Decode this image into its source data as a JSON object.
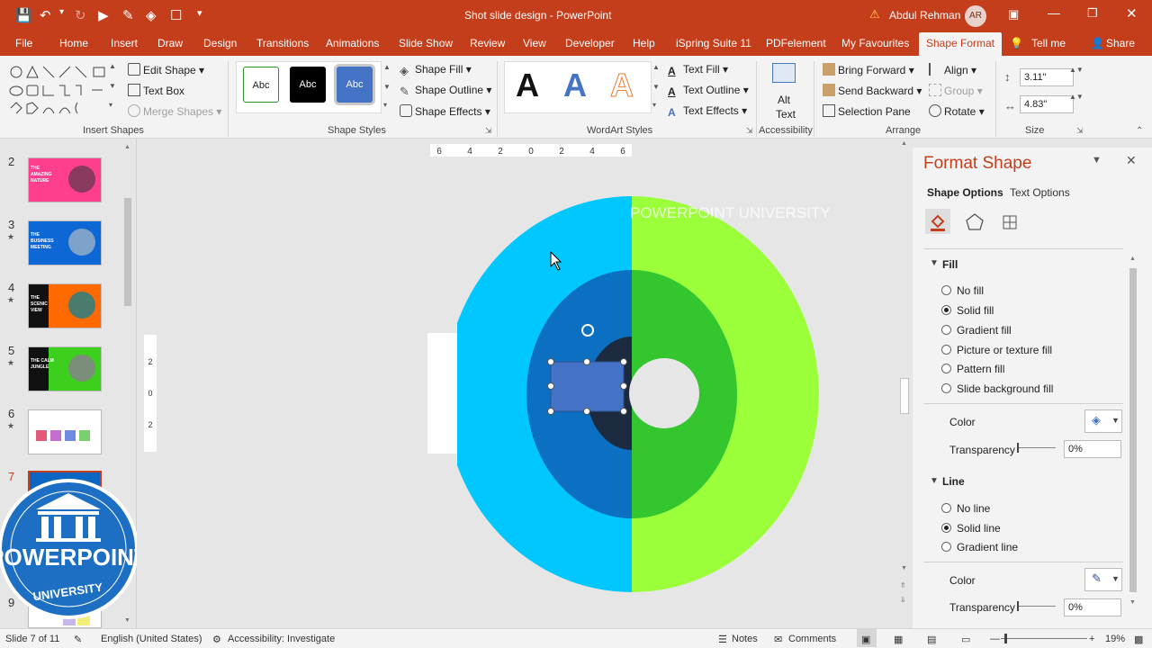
{
  "window": {
    "title": "Shot slide design - PowerPoint",
    "user_name": "Abdul Rehman",
    "user_initials": "AR"
  },
  "tabs": [
    "File",
    "Home",
    "Insert",
    "Draw",
    "Design",
    "Transitions",
    "Animations",
    "Slide Show",
    "Review",
    "View",
    "Developer",
    "Help",
    "iSpring Suite 11",
    "PDFelement",
    "My Favourites",
    "Shape Format"
  ],
  "tell_me": "Tell me",
  "share": "Share",
  "ribbon": {
    "insert_shapes": {
      "label": "Insert Shapes",
      "edit_shape": "Edit Shape",
      "text_box": "Text Box",
      "merge_shapes": "Merge Shapes"
    },
    "shape_styles": {
      "label": "Shape Styles",
      "sample": "Abc",
      "shape_fill": "Shape Fill",
      "shape_outline": "Shape Outline",
      "shape_effects": "Shape Effects"
    },
    "wordart_styles": {
      "label": "WordArt Styles",
      "letter": "A",
      "text_fill": "Text Fill",
      "text_outline": "Text Outline",
      "text_effects": "Text Effects"
    },
    "accessibility": {
      "label": "Accessibility",
      "alt_text_line1": "Alt",
      "alt_text_line2": "Text"
    },
    "arrange": {
      "label": "Arrange",
      "bring_forward": "Bring Forward",
      "send_backward": "Send Backward",
      "selection_pane": "Selection Pane",
      "align": "Align",
      "group": "Group",
      "rotate": "Rotate"
    },
    "size": {
      "label": "Size",
      "height": "3.11\"",
      "width": "4.83\""
    }
  },
  "ruler": {
    "h_ticks": [
      "6",
      "4",
      "2",
      "0",
      "2",
      "4",
      "6"
    ],
    "v_ticks": [
      "2",
      "0",
      "2"
    ]
  },
  "slides": [
    {
      "num": "2",
      "star": "",
      "title": "THE AMAZING NATURE",
      "bg": "#ff3f8e"
    },
    {
      "num": "3",
      "star": "★",
      "title": "THE BUSINESS MEETING",
      "bg": "#0d67d4"
    },
    {
      "num": "4",
      "star": "★",
      "title": "THE SCENIC VIEW",
      "bg": "#ff6a00"
    },
    {
      "num": "5",
      "star": "★",
      "title": "THE CALM JUNGLE",
      "bg": "#3ccf1e"
    },
    {
      "num": "6",
      "star": "★",
      "title": "",
      "bg": "#ffffff"
    },
    {
      "num": "7",
      "star": "",
      "title": "",
      "bg": "#0b66c2"
    },
    {
      "num": "9",
      "star": "",
      "title": "",
      "bg": "#ffffff"
    }
  ],
  "slide_canvas": {
    "watermark": "POWERPOINT UNIVERSITY",
    "colors": {
      "outer_left": "#00c8ff",
      "outer_right": "#9bff3a",
      "middle_left": "#0b6fc2",
      "middle_right": "#33c62e",
      "inner_left": "#1b2a3e",
      "selected_shape": "#4472c4"
    }
  },
  "logo": {
    "line1": "POWERPOINT",
    "line2": "UNIVERSITY"
  },
  "format_pane": {
    "title": "Format Shape",
    "tab_shape_options": "Shape Options",
    "tab_text_options": "Text Options",
    "fill_section": "Fill",
    "fill_options": [
      "No fill",
      "Solid fill",
      "Gradient fill",
      "Picture or texture fill",
      "Pattern fill",
      "Slide background fill"
    ],
    "fill_selected": "Solid fill",
    "color_label": "Color",
    "transparency_label": "Transparency",
    "fill_transparency": "0%",
    "line_section": "Line",
    "line_options": [
      "No line",
      "Solid line",
      "Gradient line"
    ],
    "line_selected": "Solid line",
    "line_color_label": "Color",
    "line_transparency_label": "Transparency",
    "line_transparency": "0%"
  },
  "status": {
    "slide_info": "Slide 7 of 11",
    "language": "English (United States)",
    "accessibility": "Accessibility: Investigate",
    "notes": "Notes",
    "comments": "Comments",
    "zoom": "19%"
  }
}
